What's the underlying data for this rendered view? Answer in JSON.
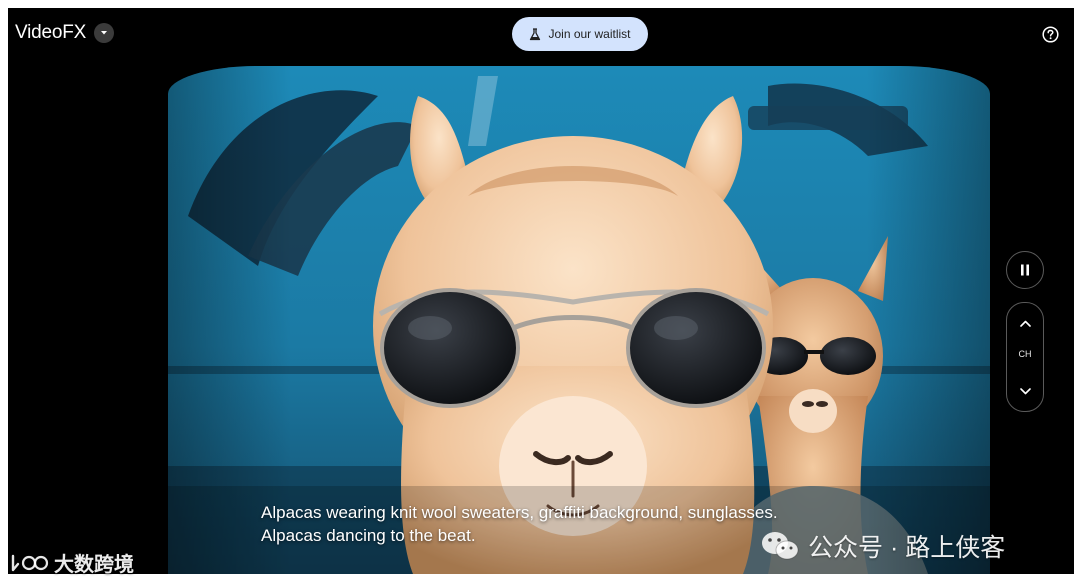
{
  "app": {
    "title": "VideoFX",
    "menu_icon": "caret-down-icon"
  },
  "header": {
    "waitlist_label": "Join our waitlist",
    "waitlist_icon": "flask-icon",
    "help_icon": "help-circle-icon"
  },
  "player": {
    "caption_line1": "Alpacas wearing knit wool sweaters, graffiti background, sunglasses.",
    "caption_line2": "Alpacas dancing to the beat.",
    "pause_icon": "pause-icon",
    "channel_label": "CH",
    "channel_up_icon": "chevron-up-icon",
    "channel_down_icon": "chevron-down-icon"
  },
  "watermarks": {
    "wechat_text": "公众号 · 路上侠客",
    "brand_text": "大数跨境"
  },
  "colors": {
    "background": "#000000",
    "waitlist_button": "#d3e3fd",
    "graffiti_blue": "#1e88b4"
  }
}
